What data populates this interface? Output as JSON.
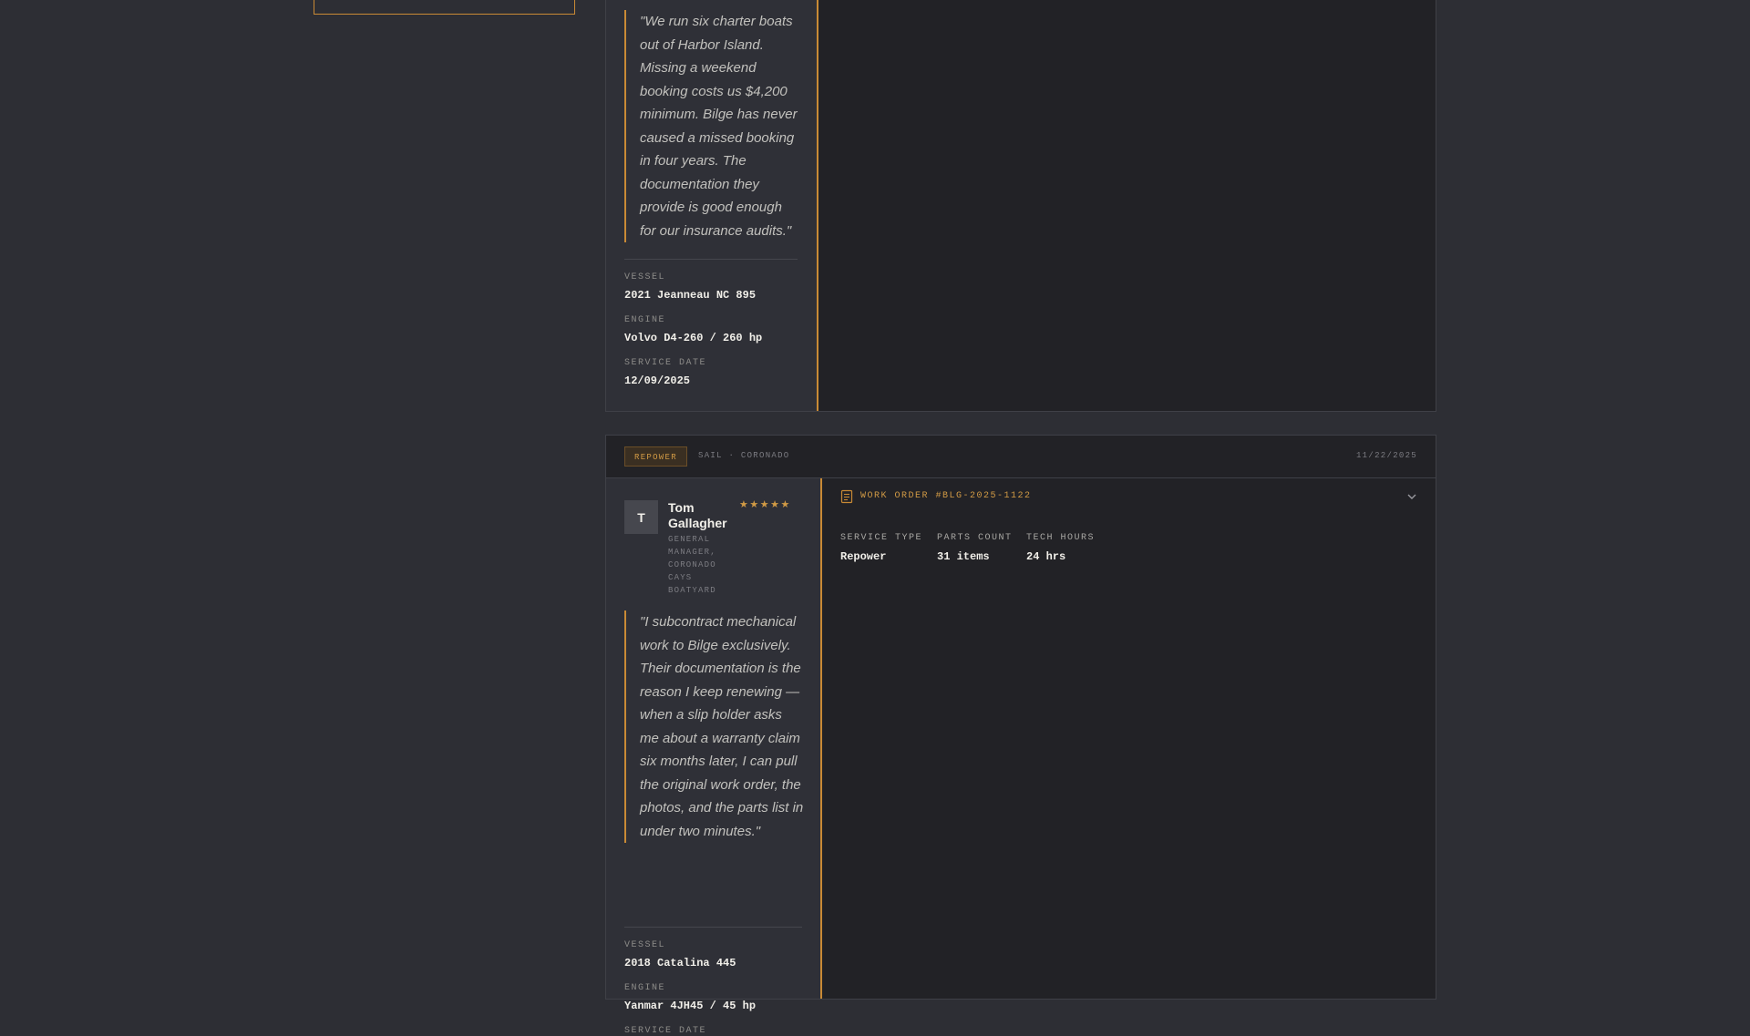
{
  "theme": {
    "accent": "#c98a35",
    "page_bg": "#2d2e34",
    "panel_bg": "#222226"
  },
  "testimonials": [
    {
      "quote": "\"We run six charter boats out of Harbor Island. Missing a weekend booking costs us $4,200 minimum. Bilge has never caused a missed booking in four years. The documentation they provide is good enough for our insurance audits.\"",
      "specs": [
        {
          "label": "VESSEL",
          "value": "2021 Jeanneau NC 895"
        },
        {
          "label": "ENGINE",
          "value": "Volvo D4-260 / 260 hp"
        },
        {
          "label": "SERVICE DATE",
          "value": "12/09/2025"
        }
      ]
    },
    {
      "tag": "REPOWER",
      "meta": "SAIL · CORONADO",
      "date": "11/22/2025",
      "reviewer": {
        "initial": "T",
        "name": "Tom Gallagher",
        "role": "GENERAL MANAGER, CORONADO CAYS BOATYARD",
        "stars": "★★★★★",
        "rating": 5
      },
      "quote": "\"I subcontract mechanical work to Bilge exclusively. Their documentation is the reason I keep renewing — when a slip holder asks me about a warranty claim six months later, I can pull the original work order, the photos, and the parts list in under two minutes.\"",
      "specs": [
        {
          "label": "VESSEL",
          "value": "2018 Catalina 445"
        },
        {
          "label": "ENGINE",
          "value": "Yanmar 4JH45 / 45 hp"
        },
        {
          "label": "SERVICE DATE",
          "value": ""
        }
      ],
      "work_order": {
        "icon": "document-icon",
        "title": "WORK ORDER #BLG-2025-1122",
        "toggle_icon": "chevron-down-icon",
        "stats": [
          {
            "label": "SERVICE TYPE",
            "value": "Repower"
          },
          {
            "label": "PARTS COUNT",
            "value": "31 items"
          },
          {
            "label": "TECH HOURS",
            "value": "24 hrs"
          }
        ]
      }
    }
  ]
}
